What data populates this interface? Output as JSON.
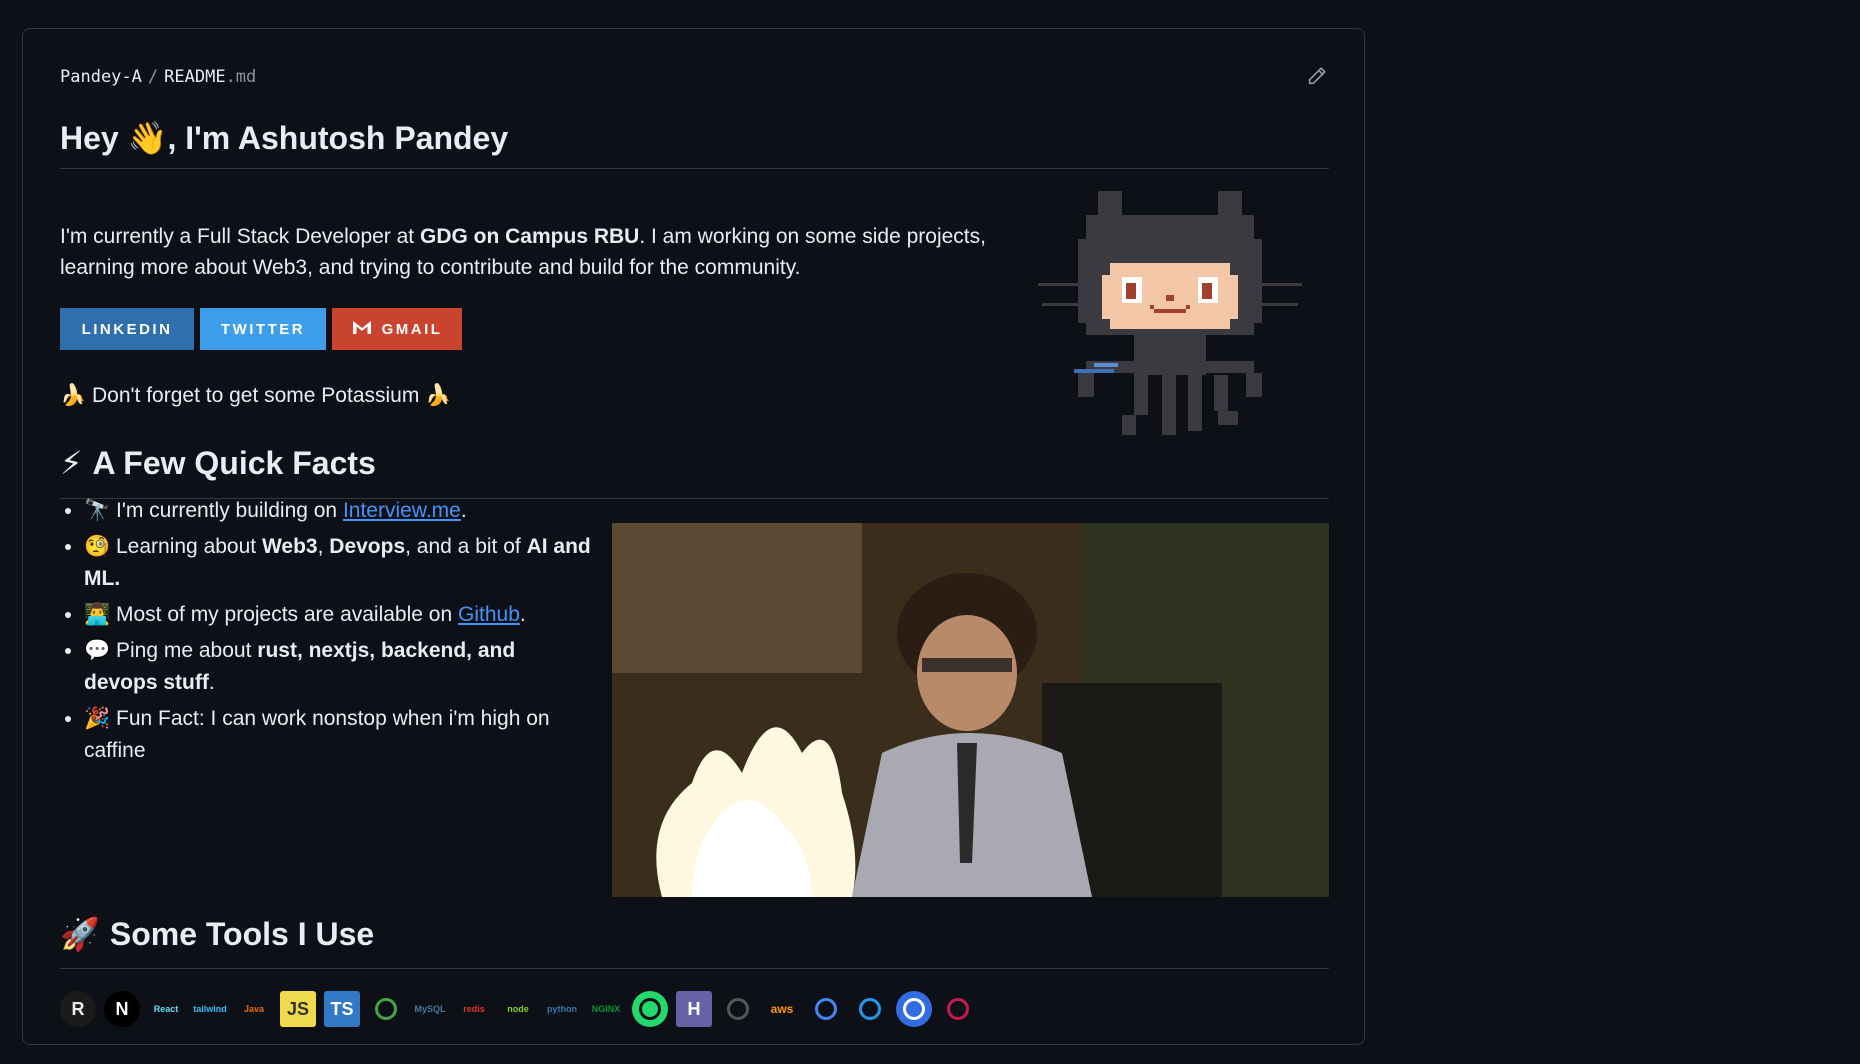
{
  "file_path": {
    "owner": "Pandey-A",
    "separator": "/",
    "filename": "README",
    "extension": ".md"
  },
  "header": {
    "title": "Hey 👋, I'm Ashutosh Pandey"
  },
  "intro": {
    "part1": "I'm currently a Full Stack Developer at ",
    "bold": "GDG on Campus RBU",
    "part2": ". I am working on some side projects, learning more about Web3, and trying to contribute and build for the community."
  },
  "badges": {
    "linkedin": "LINKEDIN",
    "twitter": "TWITTER",
    "gmail": "GMAIL"
  },
  "potassium": {
    "emoji": "🍌",
    "text": "Don't forget to get some Potassium"
  },
  "quick_facts": {
    "emoji": "⚡",
    "title": "A Few Quick Facts",
    "items": [
      {
        "emoji": "🔭",
        "pre": "I'm currently building on ",
        "link": "Interview.me",
        "post": "."
      },
      {
        "emoji": "🧐",
        "pre": "Learning about ",
        "b1": "Web3",
        "mid1": ", ",
        "b2": "Devops",
        "mid2": ", and a bit of ",
        "b3": "AI and ML",
        "post": "."
      },
      {
        "emoji": "👨‍💻",
        "pre": "Most of my projects are available on ",
        "link": "Github",
        "post": "."
      },
      {
        "emoji": "💬",
        "pre": "Ping me about ",
        "bold": "rust, nextjs, backend, and devops stuff",
        "post": "."
      },
      {
        "emoji": "🎉",
        "pre": "Fun Fact: I can work nonstop when i'm high on caffine"
      }
    ]
  },
  "tools_section": {
    "emoji": "🚀",
    "title": "Some Tools I Use",
    "items": [
      {
        "name": "rust-icon",
        "label": "R",
        "color": "#1b1b1b",
        "fg": "#e6edf3"
      },
      {
        "name": "nextjs-icon",
        "label": "N",
        "color": "#000000",
        "fg": "#ffffff"
      },
      {
        "name": "react-icon",
        "label": "React",
        "color": "transparent",
        "fg": "#61dafb"
      },
      {
        "name": "tailwind-icon",
        "label": "tailwind",
        "color": "transparent",
        "fg": "#38bdf8"
      },
      {
        "name": "java-icon",
        "label": "Java",
        "color": "transparent",
        "fg": "#e76f00"
      },
      {
        "name": "javascript-icon",
        "label": "JS",
        "color": "#f0db4f",
        "fg": "#323330"
      },
      {
        "name": "typescript-icon",
        "label": "TS",
        "color": "#3178c6",
        "fg": "#ffffff"
      },
      {
        "name": "mongodb-icon",
        "label": "",
        "color": "transparent",
        "fg": "#47a248"
      },
      {
        "name": "mysql-icon",
        "label": "MySQL",
        "color": "transparent",
        "fg": "#4479a1"
      },
      {
        "name": "redis-icon",
        "label": "redis",
        "color": "transparent",
        "fg": "#dc382d"
      },
      {
        "name": "nodejs-icon",
        "label": "node",
        "color": "transparent",
        "fg": "#83cd29"
      },
      {
        "name": "python-icon",
        "label": "python",
        "color": "transparent",
        "fg": "#3776ab"
      },
      {
        "name": "nginx-icon",
        "label": "NGINX",
        "color": "transparent",
        "fg": "#009639"
      },
      {
        "name": "cucumber-icon",
        "label": "",
        "color": "#23d96c",
        "fg": "#0d1117"
      },
      {
        "name": "heroku-icon",
        "label": "H",
        "color": "#6762a6",
        "fg": "#ffffff"
      },
      {
        "name": "openai-icon",
        "label": "",
        "color": "transparent",
        "fg": "#555555"
      },
      {
        "name": "aws-icon",
        "label": "aws",
        "color": "transparent",
        "fg": "#ff9900"
      },
      {
        "name": "gcp-icon",
        "label": "",
        "color": "transparent",
        "fg": "#4285f4"
      },
      {
        "name": "docker-icon",
        "label": "",
        "color": "transparent",
        "fg": "#2496ed"
      },
      {
        "name": "kubernetes-icon",
        "label": "",
        "color": "#326ce5",
        "fg": "#ffffff"
      },
      {
        "name": "raspberrypi-icon",
        "label": "",
        "color": "transparent",
        "fg": "#c51a4a"
      }
    ]
  },
  "colors": {
    "background": "#0d1117",
    "border": "#30363d",
    "link": "#4493f8"
  }
}
